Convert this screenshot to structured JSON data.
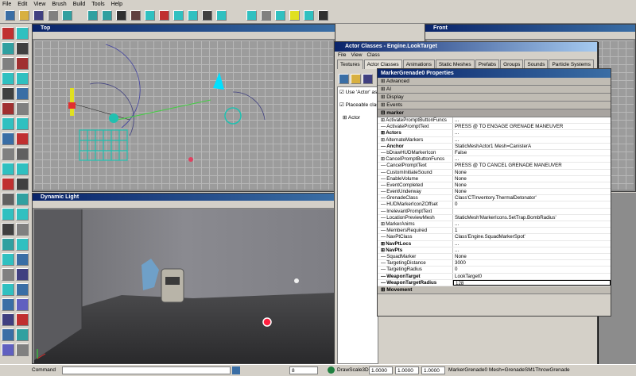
{
  "menu": [
    "File",
    "Edit",
    "View",
    "Brush",
    "Build",
    "Tools",
    "Help"
  ],
  "viewports": {
    "top": "Top",
    "front": "Front",
    "dynamic": "Dynamic Light"
  },
  "actor_window": {
    "title": "Actor Classes - Engine.LookTarget",
    "menu": [
      "File",
      "View",
      "Class"
    ],
    "tabs": [
      "Textures",
      "Actor Classes",
      "Animations",
      "Static Meshes",
      "Prefabs",
      "Groups",
      "Sounds",
      "Particle Systems"
    ],
    "check1": "Use 'Actor' as",
    "check2": "Placeable clas",
    "tree_item": "Actor"
  },
  "properties": {
    "title": "MarkerGrenade0 Properties",
    "categories_top": [
      "Advanced",
      "AI",
      "Display",
      "Events"
    ],
    "marker_label": "marker",
    "rows": [
      {
        "k": "ActivatePromptButtonFuncs",
        "v": "...",
        "prefix": "⊞"
      },
      {
        "k": "ActivatePromptText",
        "v": "PRESS @ TO ENGAGE GRENADE MANEUVER"
      },
      {
        "k": "Actors",
        "v": "...",
        "bold": true,
        "prefix": "⊞"
      },
      {
        "k": "AlternateMarkers",
        "v": "...",
        "prefix": "⊞"
      },
      {
        "k": "Anchor",
        "v": "StaticMeshActor1 Mesh=CanisterA",
        "bold": true
      },
      {
        "k": "bDrawHUDMarkerIcon",
        "v": "False"
      },
      {
        "k": "CancelPromptButtonFuncs",
        "v": "...",
        "prefix": "⊞"
      },
      {
        "k": "CancelPromptText",
        "v": "PRESS @ TO CANCEL GRENADE MANEUVER"
      },
      {
        "k": "CustomInitiateSound",
        "v": "None"
      },
      {
        "k": "EnableVolume",
        "v": "None"
      },
      {
        "k": "EventCompleted",
        "v": "None"
      },
      {
        "k": "EventUnderway",
        "v": "None"
      },
      {
        "k": "GrenadeClass",
        "v": "Class'CTInventory.ThermalDetonator'"
      },
      {
        "k": "HUDMarkerIconZOffset",
        "v": "0"
      },
      {
        "k": "IrrelevantPromptText",
        "v": ""
      },
      {
        "k": "LocationPreviewMesh",
        "v": "StaticMesh'MarkerIcons.SetTrap.BombRadius'"
      },
      {
        "k": "MarkerAnims",
        "v": "...",
        "prefix": "⊞"
      },
      {
        "k": "MembersRequired",
        "v": "1"
      },
      {
        "k": "NavPtClass",
        "v": "Class'Engine.SquadMarkerSpot'"
      },
      {
        "k": "NavPtLocs",
        "v": "...",
        "bold": true,
        "prefix": "⊞"
      },
      {
        "k": "NavPts",
        "v": "...",
        "bold": true,
        "prefix": "⊞"
      },
      {
        "k": "SquadMarker",
        "v": "None"
      },
      {
        "k": "TargetingDistance",
        "v": "3000"
      },
      {
        "k": "TargetingRadius",
        "v": "0"
      },
      {
        "k": "WeaponTarget",
        "v": "LookTarget0",
        "bold": true
      },
      {
        "k": "WeaponTargetRadius",
        "v": "128",
        "bold": true,
        "sel": true
      }
    ],
    "bottom_category": "Movement"
  },
  "status": {
    "command_label": "Command",
    "snap": "8",
    "drawscale_label": "DrawScale3D",
    "scale_x": "1.0000",
    "scale_y": "1.0000",
    "scale_z": "1.0000",
    "selection": "MarkerGrenade0 Mesh=GrenadeSM1ThrowGrenade"
  },
  "colors": {
    "title": "#0a246a",
    "mesh": "#20c0b0",
    "cyan": "#00e0ff"
  }
}
